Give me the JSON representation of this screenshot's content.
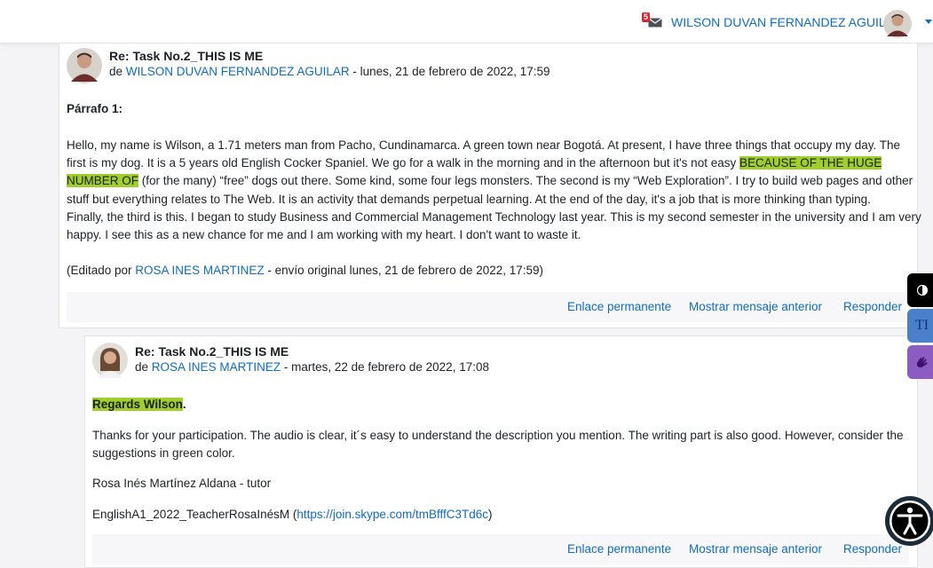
{
  "header": {
    "notification_count": "5",
    "user_name": "WILSON DUVAN FERNANDEZ AGUILAR"
  },
  "post1": {
    "subject": "Re: Task No.2_THIS IS ME",
    "by_prefix": "de",
    "author": "WILSON DUVAN FERNANDEZ AGUILAR",
    "date": " - lunes, 21 de febrero de 2022, 17:59",
    "heading": "Párrafo 1:",
    "body_lines": [
      "Hello, my name is Wilson, a 1.71 meters man from Pacho, Cundinamarca. A green town near Bogotá. At present, I have three things that occupy my day. The",
      "first is my dog. It is a 5 years old English Cocker Spaniel. We go for a walk in the morning and in the afternoon but it's not easy ",
      "BECAUSE OF THE HUGE",
      "NUMBER OF",
      " (for the many) “free” dogs out there. Some kind, some four legs monsters. The second is my “Web Exploration”. I try to build web pages and other",
      "stuff but everything relates to The Web. It is an activity that demands perpetual learning. At the end of the day, it's a job that is more thinking than typing.",
      "Finally, the third is this. I began to study Business and Commercial Management Technology last year. This is my second semester in the university and I am very",
      "happy. I see this as a new chance for me and I am working with my heart. I don't want to waste it."
    ],
    "edited_prefix": "(Editado por ",
    "edited_by": "ROSA INES MARTINEZ",
    "edited_suffix": " - envío original lunes, 21 de febrero de 2022, 17:59)",
    "actions": [
      "Enlace permanente",
      "Mostrar mensaje anterior",
      "Responder"
    ]
  },
  "post2": {
    "subject": "Re: Task No.2_THIS IS ME",
    "by_prefix": "de",
    "author": "ROSA INES MARTINEZ",
    "date": " - martes, 22 de febrero de 2022, 17:08",
    "greeting": "Regards Wilson",
    "greeting_end": ".",
    "body_line1": "Thanks for your participation. The audio is clear, it´s easy to understand the description you mention. The writing part is also good. However, consider the",
    "body_line2": "suggestions in green color.",
    "signature": "Rosa Inés Martínez Aldana - tutor",
    "contact_prefix": "EnglishA1_2022_TeacherRosaInésM (",
    "contact_link": "https://join.skype.com/tmBfffC3Td6c",
    "contact_suffix": ")",
    "actions": [
      "Enlace permanente",
      "Mostrar mensaje anterior",
      "Responder"
    ]
  },
  "side_tools": {
    "text_tool_label": "TI"
  },
  "colors": {
    "link": "#0f6cbf",
    "highlight": "#a0ce2d",
    "badge": "#d9262e"
  }
}
